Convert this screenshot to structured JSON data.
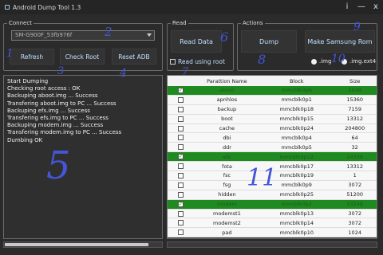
{
  "window": {
    "title": "Android Dump Tool 1.3",
    "buttons": {
      "info": "i",
      "minimize": "—",
      "close": "x"
    }
  },
  "connect": {
    "group_label": "Connect",
    "device": "SM-G900F_53fb976f",
    "buttons": {
      "refresh": "Refresh",
      "check_root": "Check Root",
      "reset_adb": "Reset ADB"
    }
  },
  "read": {
    "group_label": "Read",
    "read_data": "Read Data",
    "use_root_label": "Read using root"
  },
  "actions": {
    "group_label": "Actions",
    "dump": "Dump",
    "make_rom": "Make Samsung Rom",
    "format_options": [
      ".img",
      ".img.ext4"
    ]
  },
  "log": [
    "Start Dumping",
    "Checking root access : OK",
    "Backuping aboot.img ... Success",
    "Transfering aboot.img to PC ... Success",
    "Backuping efs.img ... Success",
    "Transfering efs.img to PC ... Success",
    "Backuping modem.img ... Success",
    "Transfering modem.img to PC ... Success",
    "Dumbing OK"
  ],
  "table": {
    "columns": [
      "",
      "Parattion Name",
      "Block",
      "Size"
    ],
    "rows": [
      {
        "checked": true,
        "name": "aboot",
        "block": "mmcblk0p6",
        "size": "2048"
      },
      {
        "checked": false,
        "name": "apnhlos",
        "block": "mmcblk0p1",
        "size": "15360"
      },
      {
        "checked": false,
        "name": "backup",
        "block": "mmcblk0p18",
        "size": "7159"
      },
      {
        "checked": false,
        "name": "boot",
        "block": "mmcblk0p15",
        "size": "13312"
      },
      {
        "checked": false,
        "name": "cache",
        "block": "mmcblk0p24",
        "size": "204800"
      },
      {
        "checked": false,
        "name": "dbi",
        "block": "mmcblk0p4",
        "size": "64"
      },
      {
        "checked": false,
        "name": "ddr",
        "block": "mmcblk0p5",
        "size": "32"
      },
      {
        "checked": true,
        "name": "efs",
        "block": "mmcblk0p12",
        "size": "14336"
      },
      {
        "checked": false,
        "name": "fota",
        "block": "mmcblk0p17",
        "size": "13312"
      },
      {
        "checked": false,
        "name": "fsc",
        "block": "mmcblk0p19",
        "size": "1"
      },
      {
        "checked": false,
        "name": "fsg",
        "block": "mmcblk0p9",
        "size": "3072"
      },
      {
        "checked": false,
        "name": "hidden",
        "block": "mmcblk0p25",
        "size": "51200"
      },
      {
        "checked": true,
        "name": "modem",
        "block": "mmcblk0p2",
        "size": "53248"
      },
      {
        "checked": false,
        "name": "modemst1",
        "block": "mmcblk0p13",
        "size": "3072"
      },
      {
        "checked": false,
        "name": "modemst2",
        "block": "mmcblk0p14",
        "size": "3072"
      },
      {
        "checked": false,
        "name": "pad",
        "block": "mmcblk0p10",
        "size": "1024"
      }
    ]
  },
  "annotations": [
    "1",
    "2",
    "3",
    "4",
    "5",
    "6",
    "7",
    "8",
    "9",
    "10",
    "11"
  ],
  "colors": {
    "background": "#2b2b2b",
    "button_text": "#bfe0ff",
    "selected_row": "#1f8a1f",
    "annotation_ink": "#4456d8"
  }
}
